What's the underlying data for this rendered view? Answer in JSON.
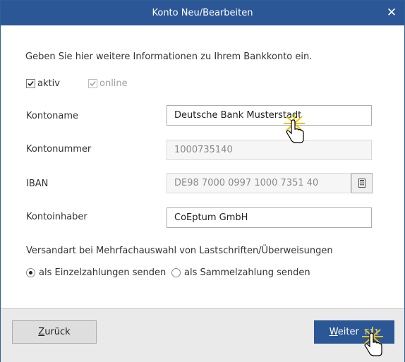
{
  "window": {
    "title": "Konto Neu/Bearbeiten",
    "close_icon": "close-icon"
  },
  "intro_text": "Geben Sie hier weitere Informationen zu Ihrem Bankkonto ein.",
  "checkboxes": {
    "aktiv": {
      "label": "aktiv",
      "checked": true
    },
    "online": {
      "label": "online",
      "checked": true,
      "disabled": true
    }
  },
  "fields": {
    "kontoname": {
      "label": "Kontoname",
      "value": "Deutsche Bank Musterstadt"
    },
    "kontonummer": {
      "label": "Kontonummer",
      "value": "1000735140"
    },
    "iban": {
      "label": "IBAN",
      "value": "DE98 7000 0997 1000 7351 40"
    },
    "kontoinhaber": {
      "label": "Kontoinhaber",
      "value": "CoEptum GmbH"
    }
  },
  "versandart": {
    "label": "Versandart bei Mehrfachauswahl von Lastschriften/Überweisungen",
    "options": [
      {
        "label": "als Einzelzahlungen senden",
        "selected": true
      },
      {
        "label": "als Sammelzahlung senden",
        "selected": false
      }
    ]
  },
  "buttons": {
    "back": {
      "label_rest": "urück",
      "label_underlined": "Z"
    },
    "next": {
      "label_underlined": "W",
      "label_rest": "eiter",
      "shortcut": "F11"
    }
  },
  "colors": {
    "titlebar": "#2b5797",
    "primary_button": "#2b5797"
  }
}
